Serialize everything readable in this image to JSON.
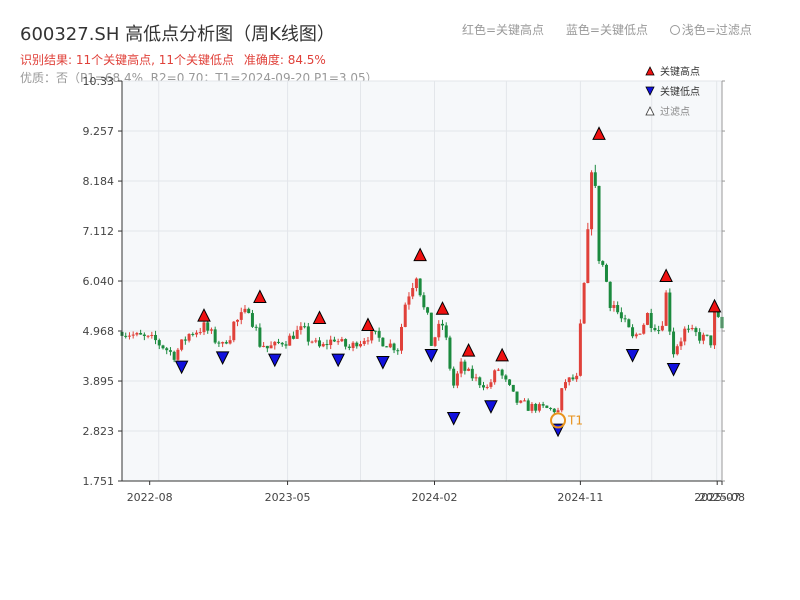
{
  "header": {
    "title": "600327.SH 高低点分析图（周K线图）",
    "legend_red": "红色=关键高点",
    "legend_blue": "蓝色=关键低点",
    "legend_light": "浅色=过滤点",
    "result": "识别结果: 11个关键高点, 11个关键低点",
    "accuracy": "准确度: 84.5%",
    "quality": "优质：否（P1=68.4%, R2=0.70；T1=2024-09-20 P1=3.05）"
  },
  "colors": {
    "up": "#e0413a",
    "down": "#1b8a3e",
    "high_marker": "#ee1111",
    "low_marker": "#1111dd",
    "t1": "#e8921c",
    "grid": "#e3e6ea",
    "plot_bg": "#f6f8fa",
    "axis": "#333333"
  },
  "chart_data": {
    "type": "candlestick",
    "interval": "weekly",
    "x_range": [
      "2022-06-24",
      "2025-07-25"
    ],
    "ylim": [
      1.751,
      10.33
    ],
    "y_ticks": [
      1.751,
      2.823,
      3.895,
      4.968,
      6.04,
      7.112,
      8.184,
      9.257,
      10.33
    ],
    "x_ticks": [
      "2022-08",
      "2023-05",
      "2024-02",
      "2024-11",
      "2025-07",
      "2025-08"
    ],
    "inner_legend": [
      "关键高点",
      "关键低点",
      "过滤点"
    ],
    "close_path": [
      [
        "2022-06-24",
        4.95
      ],
      [
        "2022-08-26",
        4.75
      ],
      [
        "2022-09-30",
        4.45
      ],
      [
        "2022-10-28",
        4.9
      ],
      [
        "2022-11-25",
        5.05
      ],
      [
        "2022-12-30",
        4.65
      ],
      [
        "2023-01-20",
        5.1
      ],
      [
        "2023-02-17",
        5.45
      ],
      [
        "2023-03-10",
        4.75
      ],
      [
        "2023-03-24",
        4.6
      ],
      [
        "2023-05-05",
        4.8
      ],
      [
        "2023-05-26",
        5.0
      ],
      [
        "2023-06-30",
        4.6
      ],
      [
        "2023-07-28",
        4.8
      ],
      [
        "2023-08-25",
        4.6
      ],
      [
        "2023-09-29",
        4.9
      ],
      [
        "2023-10-27",
        4.75
      ],
      [
        "2023-11-24",
        4.6
      ],
      [
        "2023-12-08",
        5.6
      ],
      [
        "2023-12-29",
        6.35
      ],
      [
        "2024-01-12",
        5.4
      ],
      [
        "2024-01-26",
        4.75
      ],
      [
        "2024-02-16",
        5.1
      ],
      [
        "2024-03-08",
        3.8
      ],
      [
        "2024-03-22",
        4.2
      ],
      [
        "2024-04-12",
        4.0
      ],
      [
        "2024-05-10",
        3.75
      ],
      [
        "2024-05-31",
        4.15
      ],
      [
        "2024-06-28",
        3.5
      ],
      [
        "2024-07-26",
        3.35
      ],
      [
        "2024-08-30",
        3.3
      ],
      [
        "2024-09-20",
        3.25
      ],
      [
        "2024-10-04",
        3.9
      ],
      [
        "2024-10-25",
        3.95
      ],
      [
        "2024-11-15",
        6.8
      ],
      [
        "2024-11-22",
        8.8
      ],
      [
        "2024-12-06",
        6.7
      ],
      [
        "2024-12-27",
        5.7
      ],
      [
        "2025-01-17",
        5.2
      ],
      [
        "2025-02-07",
        4.75
      ],
      [
        "2025-03-07",
        5.3
      ],
      [
        "2025-03-28",
        5.0
      ],
      [
        "2025-04-11",
        5.7
      ],
      [
        "2025-04-25",
        4.6
      ],
      [
        "2025-05-16",
        4.95
      ],
      [
        "2025-06-13",
        4.85
      ],
      [
        "2025-07-04",
        4.75
      ],
      [
        "2025-07-11",
        5.2
      ],
      [
        "2025-07-25",
        5.0
      ]
    ],
    "key_highs": [
      {
        "date": "2022-11-25",
        "price": 5.05
      },
      {
        "date": "2023-03-10",
        "price": 5.45
      },
      {
        "date": "2023-06-30",
        "price": 5.0
      },
      {
        "date": "2023-09-29",
        "price": 4.85
      },
      {
        "date": "2024-01-05",
        "price": 6.35
      },
      {
        "date": "2024-02-16",
        "price": 5.2
      },
      {
        "date": "2024-04-05",
        "price": 4.3
      },
      {
        "date": "2024-06-07",
        "price": 4.2
      },
      {
        "date": "2024-12-06",
        "price": 8.95
      },
      {
        "date": "2025-04-11",
        "price": 5.9
      },
      {
        "date": "2025-07-11",
        "price": 5.25
      }
    ],
    "key_lows": [
      {
        "date": "2022-10-14",
        "price": 4.45
      },
      {
        "date": "2022-12-30",
        "price": 4.65
      },
      {
        "date": "2023-04-07",
        "price": 4.6
      },
      {
        "date": "2023-08-04",
        "price": 4.6
      },
      {
        "date": "2023-10-27",
        "price": 4.55
      },
      {
        "date": "2024-01-26",
        "price": 4.7
      },
      {
        "date": "2024-03-08",
        "price": 3.35
      },
      {
        "date": "2024-05-17",
        "price": 3.6
      },
      {
        "date": "2024-09-20",
        "price": 3.1
      },
      {
        "date": "2025-02-07",
        "price": 4.7
      },
      {
        "date": "2025-04-25",
        "price": 4.4
      }
    ],
    "t1": {
      "label": "T1",
      "date": "2024-09-20",
      "price": 3.05
    }
  }
}
